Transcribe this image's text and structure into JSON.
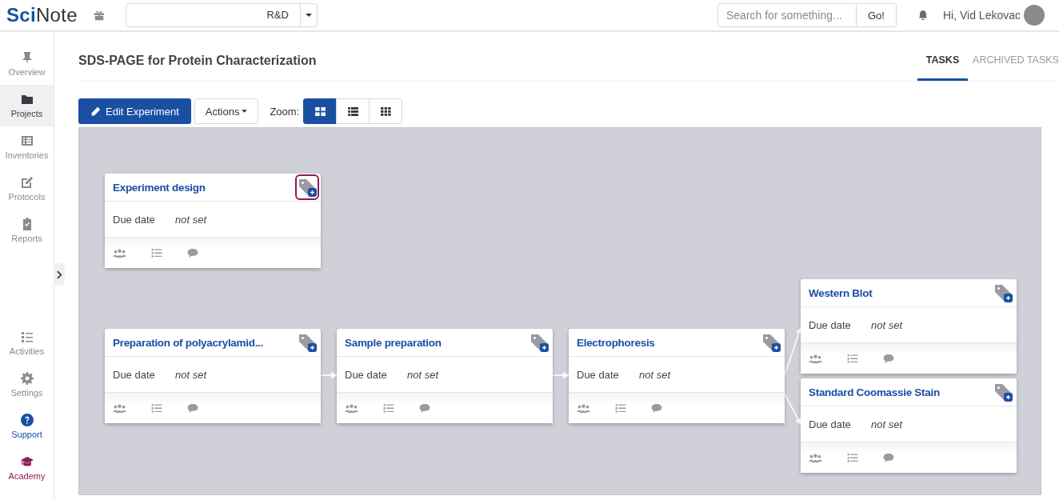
{
  "header": {
    "logo": "**Sci**Note",
    "team": "R&D",
    "search": {
      "placeholder": "Search for something..."
    },
    "go_button": "Go!",
    "greeting": "Hi, Vid Lekovac"
  },
  "sidebar": {
    "items": [
      {
        "label": "Overview",
        "selected": false,
        "color": "#8a8a8f"
      },
      {
        "label": "Projects",
        "selected": true,
        "color": "#3b3b40"
      },
      {
        "label": "Inventories",
        "selected": false,
        "color": "#8a8a8f"
      },
      {
        "label": "Protocols",
        "selected": false,
        "color": "#8a8a8f"
      },
      {
        "label": "Reports",
        "selected": false,
        "color": "#8a8a8f"
      }
    ],
    "bottom_items": [
      {
        "label": "Activities",
        "selected": false,
        "color": "#8a8a8f"
      },
      {
        "label": "Settings",
        "selected": false,
        "color": "#8a8a8f"
      },
      {
        "label": "Support",
        "selected": false,
        "color": "#1a4fa3"
      },
      {
        "label": "Academy",
        "selected": false,
        "color": "#8c1d55"
      }
    ]
  },
  "page": {
    "title": "SDS-PAGE for Protein Characterization",
    "tabs": [
      {
        "label": "TASKS",
        "selected": true
      },
      {
        "label": "ARCHIVED TASKS",
        "selected": false
      }
    ]
  },
  "toolbar": {
    "edit_button": "Edit Experiment",
    "actions_button": "Actions",
    "zoom_label": "Zoom:",
    "zoom_options": [
      {
        "selected": true
      },
      {
        "selected": false
      },
      {
        "selected": false
      }
    ]
  },
  "canvas": {
    "tasks": [
      {
        "name": "Experiment design",
        "due_label": "Due date",
        "due_value": "not set",
        "tag_highlighted": true
      },
      {
        "name": "Preparation of polyacrylamid...",
        "due_label": "Due date",
        "due_value": "not set",
        "tag_highlighted": false
      },
      {
        "name": "Sample preparation",
        "due_label": "Due date",
        "due_value": "not set",
        "tag_highlighted": false
      },
      {
        "name": "Electrophoresis",
        "due_label": "Due date",
        "due_value": "not set",
        "tag_highlighted": false
      },
      {
        "name": "Western Blot",
        "due_label": "Due date",
        "due_value": "not set",
        "tag_highlighted": false
      },
      {
        "name": "Standard Coomassie Stain",
        "due_label": "Due date",
        "due_value": "not set",
        "tag_highlighted": false
      }
    ]
  }
}
